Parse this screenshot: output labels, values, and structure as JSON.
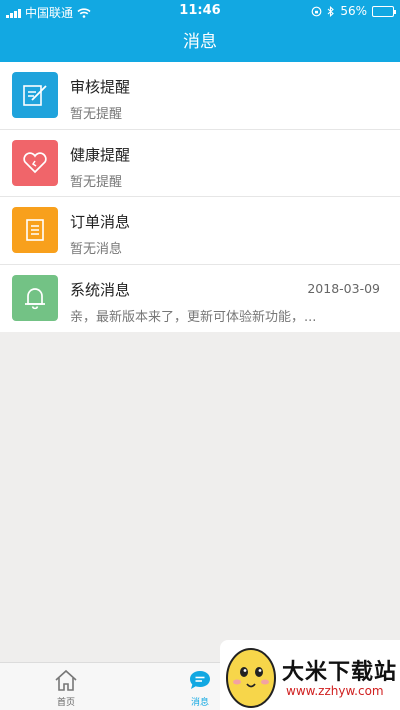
{
  "status_bar": {
    "carrier": "中国联通",
    "time": "11:46",
    "battery": "56%",
    "battery_level": 0.56
  },
  "header": {
    "title": "消息"
  },
  "messages": [
    {
      "title": "审核提醒",
      "subtitle": "暂无提醒",
      "date": "",
      "icon": "review-icon",
      "color": "#1fa3dc"
    },
    {
      "title": "健康提醒",
      "subtitle": "暂无提醒",
      "date": "",
      "icon": "heart-icon",
      "color": "#f0656a"
    },
    {
      "title": "订单消息",
      "subtitle": "暂无消息",
      "date": "",
      "icon": "order-list-icon",
      "color": "#f8a01c"
    },
    {
      "title": "系统消息",
      "subtitle": "亲，最新版本来了，更新可体验新功能，...",
      "date": "2018-03-09",
      "icon": "bell-icon",
      "color": "#73c285"
    }
  ],
  "tabs": [
    {
      "label": "首页",
      "icon": "home-icon",
      "active": false
    },
    {
      "label": "消息",
      "icon": "message-icon",
      "active": true
    }
  ],
  "watermark": {
    "title": "大米下载站",
    "url": "www.zzhyw.com"
  },
  "colors": {
    "primary": "#12a8e2"
  }
}
